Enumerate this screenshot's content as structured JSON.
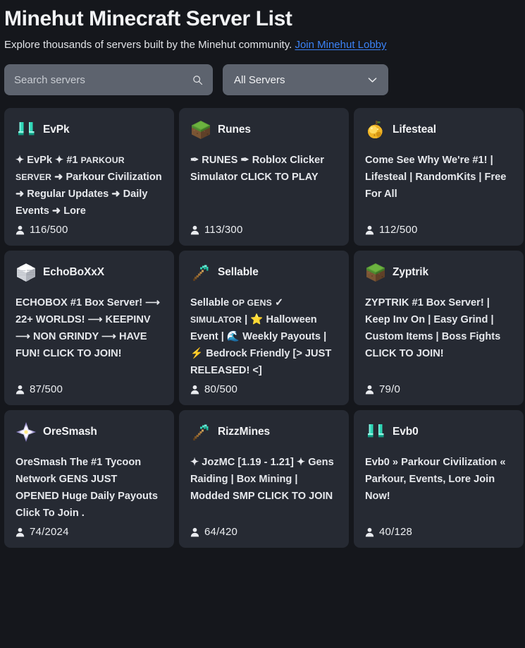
{
  "header": {
    "title": "Minehut Minecraft Server List",
    "subtitle": "Explore thousands of servers built by the Minehut community.",
    "lobby_link": "Join Minehut Lobby",
    "link_color": "#3b82f6"
  },
  "controls": {
    "search_placeholder": "Search servers",
    "search_value": "",
    "search_icon": "search-icon",
    "filter_label": "All Servers",
    "filter_icon": "chevron-down-icon",
    "filter_options": [
      "All Servers"
    ]
  },
  "colors": {
    "page_background": "#15171c",
    "card_background": "#262a33",
    "control_background": "#5d636e",
    "text_primary": "#f1f2f4",
    "text_body": "#e6e8ec"
  },
  "servers": [
    {
      "name": "EvPk",
      "icon": "diamond-boots-icon",
      "motd": "✦ EvPk ✦ #1 PARKOUR SERVER ➜ Parkour Civilization ➜ Regular Updates ➜ Daily Events ➜ Lore",
      "motd_parts": [
        {
          "t": "✦ EvPk ✦ #1 ",
          "smallcaps": false
        },
        {
          "t": "PARKOUR SERVER",
          "smallcaps": true
        },
        {
          "t": " ➜ Parkour Civilization ➜ Regular Updates ➜ Daily Events ➜ Lore",
          "smallcaps": false
        }
      ],
      "players_online": 116,
      "players_max": 500,
      "players_text": "116/500"
    },
    {
      "name": "Runes",
      "icon": "grass-block-icon",
      "motd": "✒ RUNES ✒ Roblox Clicker Simulator CLICK TO PLAY",
      "motd_parts": [
        {
          "t": "✒ RUNES ✒ Roblox Clicker Simulator CLICK TO PLAY",
          "smallcaps": false
        }
      ],
      "players_online": 113,
      "players_max": 300,
      "players_text": "113/300"
    },
    {
      "name": "Lifesteal",
      "icon": "golden-apple-icon",
      "motd": "Come See Why We're #1! | Lifesteal | RandomKits | Free For All",
      "motd_parts": [
        {
          "t": "Come See Why We're #1! | Lifesteal | RandomKits | Free For All",
          "smallcaps": false
        }
      ],
      "players_online": 112,
      "players_max": 500,
      "players_text": "112/500"
    },
    {
      "name": "EchoBoXxX",
      "icon": "white-box-icon",
      "motd": "ECHOBOX #1 Box Server! ⟶ 22+ WORLDS! ⟶ KEEPINV ⟶ NON GRINDY ⟶ HAVE FUN! CLICK TO JOIN!",
      "motd_parts": [
        {
          "t": "ECHOBOX #1 Box Server! ⟶ 22+ WORLDS! ⟶ KEEPINV ⟶ NON GRINDY ⟶ HAVE FUN! CLICK TO JOIN!",
          "smallcaps": false
        }
      ],
      "players_online": 87,
      "players_max": 500,
      "players_text": "87/500"
    },
    {
      "name": "Sellable",
      "icon": "diamond-pickaxe-icon",
      "motd": "Sellable OP GENS ✓ SIMULATOR | ⭐ Halloween Event | 🌊 Weekly Payouts | ⚡ Bedrock Friendly [> JUST RELEASED! <]",
      "motd_parts": [
        {
          "t": "Sellable ",
          "smallcaps": false
        },
        {
          "t": "OP GENS",
          "smallcaps": true
        },
        {
          "t": " ✓ ",
          "smallcaps": false
        },
        {
          "t": "SIMULATOR",
          "smallcaps": true
        },
        {
          "t": " | ⭐ Halloween Event | 🌊 Weekly Payouts | ⚡ Bedrock Friendly [> JUST RELEASED! <]",
          "smallcaps": false
        }
      ],
      "players_online": 80,
      "players_max": 500,
      "players_text": "80/500"
    },
    {
      "name": "Zyptrik",
      "icon": "grass-block-icon",
      "motd": "ZYPTRIK #1 Box Server! | Keep Inv On | Easy Grind | Custom Items | Boss Fights CLICK TO JOIN!",
      "motd_parts": [
        {
          "t": "ZYPTRIK #1 Box Server! | Keep Inv On | Easy Grind | Custom Items | Boss Fights CLICK TO JOIN!",
          "smallcaps": false
        }
      ],
      "players_online": 79,
      "players_max": 0,
      "players_text": "79/0"
    },
    {
      "name": "OreSmash",
      "icon": "nether-star-icon",
      "motd": "OreSmash The #1 Tycoon Network GENS JUST OPENED Huge Daily Payouts Click To Join .",
      "motd_parts": [
        {
          "t": "OreSmash The #1 Tycoon Network GENS JUST OPENED Huge Daily Payouts Click To Join .",
          "smallcaps": false
        }
      ],
      "players_online": 74,
      "players_max": 2024,
      "players_text": "74/2024"
    },
    {
      "name": "RizzMines",
      "icon": "diamond-pickaxe-icon",
      "motd": "✦ JozMC [1.19 - 1.21] ✦ Gens Raiding | Box Mining | Modded SMP CLICK TO JOIN",
      "motd_parts": [
        {
          "t": "✦ JozMC [1.19 - 1.21] ✦ Gens Raiding | Box Mining | Modded SMP CLICK TO JOIN",
          "smallcaps": false
        }
      ],
      "players_online": 64,
      "players_max": 420,
      "players_text": "64/420"
    },
    {
      "name": "Evb0",
      "icon": "diamond-boots-icon",
      "motd": "Evb0 » Parkour Civilization « Parkour, Events, Lore Join Now!",
      "motd_parts": [
        {
          "t": "Evb0 » Parkour Civilization « Parkour, Events, Lore Join Now!",
          "smallcaps": false
        }
      ],
      "players_online": 40,
      "players_max": 128,
      "players_text": "40/128"
    }
  ]
}
